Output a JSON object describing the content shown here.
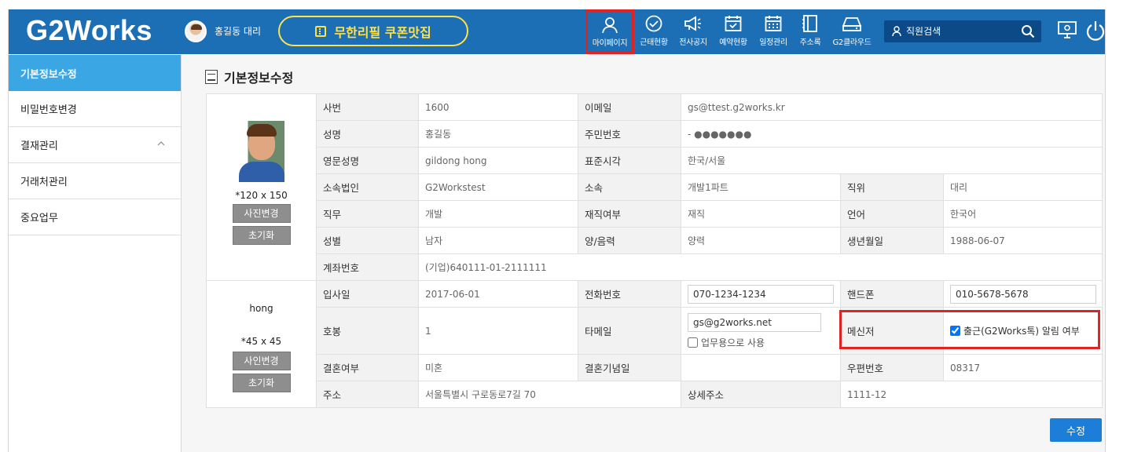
{
  "header": {
    "logo": "G2Works",
    "user_name": "홍길동 대리",
    "coupon_label": "무한리필 쿠폰맛집",
    "nav": [
      {
        "label": "마이페이지",
        "icon": "person-icon",
        "selected": true
      },
      {
        "label": "근태현황",
        "icon": "check-circle-icon"
      },
      {
        "label": "전사공지",
        "icon": "megaphone-icon"
      },
      {
        "label": "예약현황",
        "icon": "calendar-check-icon"
      },
      {
        "label": "일정관리",
        "icon": "calendar-grid-icon"
      },
      {
        "label": "주소록",
        "icon": "addressbook-icon"
      },
      {
        "label": "G2클라우드",
        "icon": "cloud-drive-icon"
      }
    ],
    "search_placeholder": "직원검색"
  },
  "sidebar": {
    "items": [
      {
        "label": "기본정보수정",
        "active": true
      },
      {
        "label": "비밀번호변경"
      },
      {
        "label": "결재관리",
        "expand": true
      },
      {
        "label": "거래처관리"
      },
      {
        "label": "중요업무"
      }
    ]
  },
  "main": {
    "title": "기본정보수정",
    "photo": {
      "size": "*120 x 150",
      "change_label": "사진변경",
      "reset_label": "초기화"
    },
    "sign": {
      "text": "hong",
      "size": "*45 x 45",
      "change_label": "사인변경",
      "reset_label": "초기화"
    },
    "labels": {
      "emp_no": "사번",
      "email": "이메일",
      "name": "성명",
      "resident_no": "주민번호",
      "eng_name": "영문성명",
      "timezone": "표준시각",
      "corp": "소속법인",
      "dept": "소속",
      "position": "직위",
      "job": "직무",
      "employment": "재직여부",
      "language": "언어",
      "gender": "성별",
      "calendar_type": "양/음력",
      "birth": "생년월일",
      "account": "계좌번호",
      "join_date": "입사일",
      "phone": "전화번호",
      "mobile": "핸드폰",
      "grade": "호봉",
      "other_email": "타메일",
      "messenger": "메신저",
      "married": "결혼여부",
      "anniversary": "결혼기념일",
      "zip": "우편번호",
      "address": "주소",
      "address_detail": "상세주소"
    },
    "values": {
      "emp_no": "1600",
      "email": "gs@ttest.g2works.kr",
      "name": "홍길동",
      "resident_no": "- ●●●●●●●",
      "eng_name": "gildong hong",
      "timezone": "한국/서울",
      "corp": "G2Workstest",
      "dept": "개발1파트",
      "position": "대리",
      "job": "개발",
      "employment": "재직",
      "language": "한국어",
      "gender": "남자",
      "calendar_type": "양력",
      "birth": "1988-06-07",
      "account": "(기업)640111-01-2111111",
      "join_date": "2017-06-01",
      "phone": "070-1234-1234",
      "mobile": "010-5678-5678",
      "grade": "1",
      "other_email": "gs@g2works.net",
      "other_email_business_label": "업무용으로 사용",
      "messenger_label": "출근(G2Works톡) 알림 여부",
      "married": "미혼",
      "anniversary": "",
      "zip": "08317",
      "address": "서울특별시 구로동로7길 70",
      "address_detail": "1111-12"
    },
    "submit_label": "수정"
  }
}
